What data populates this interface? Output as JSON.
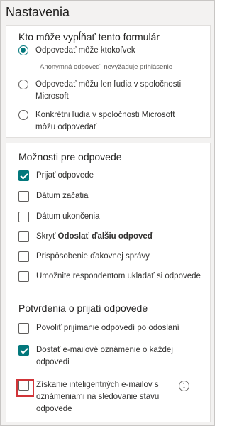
{
  "panel": {
    "title": "Nastavenia"
  },
  "who_can_fill": {
    "title": "Kto môže vypĺňať tento formulár",
    "options": [
      {
        "label": "Odpovedať môže ktokoľvek",
        "selected": true
      },
      {
        "label": "Odpovedať môžu len ľudia v spoločnosti Microsoft",
        "selected": false
      },
      {
        "label": "Konkrétni ľudia v spoločnosti Microsoft môžu odpovedať",
        "selected": false
      }
    ],
    "anonymous_hint": "Anonymná odpoveď, nevyžaduje prihlásenie"
  },
  "response_options": {
    "title": "Možnosti pre odpovede",
    "items": [
      {
        "label": "Prijať odpovede",
        "checked": true
      },
      {
        "label": "Dátum začatia",
        "checked": false
      },
      {
        "label": "Dátum ukončenia",
        "checked": false
      },
      {
        "label_prefix": "Skryť ",
        "label_bold": "Odoslať ďalšiu odpoveď",
        "checked": false
      },
      {
        "label": "Prispôsobenie ďakovnej správy",
        "checked": false
      },
      {
        "label": "Umožnite respondentom ukladať si odpovede",
        "checked": false
      }
    ]
  },
  "receipt": {
    "title": "Potvrdenia o prijatí odpovede",
    "items": [
      {
        "label": "Povoliť prijímanie odpovedí po odoslaní",
        "checked": false
      },
      {
        "label": "Dostať e-mailové oznámenie o každej odpovedi",
        "checked": true
      },
      {
        "label": "Získanie inteligentných e-mailov s oznámeniami na sledovanie stavu odpovede",
        "checked": false
      }
    ],
    "info_icon": "info-icon"
  },
  "colors": {
    "accent": "#03787c",
    "highlight": "#d13438"
  }
}
